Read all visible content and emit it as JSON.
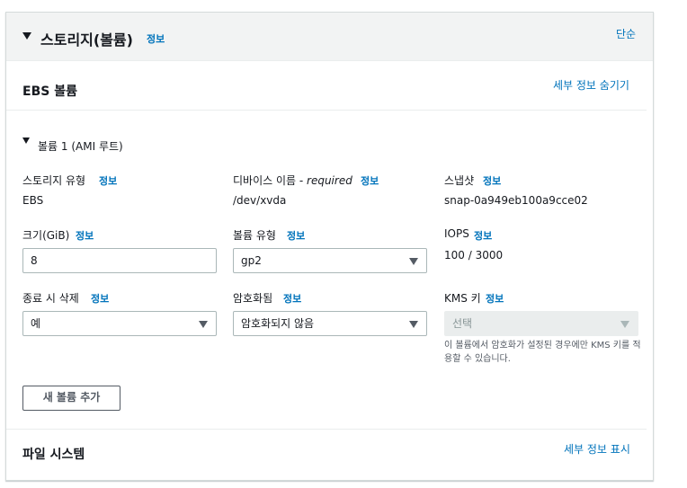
{
  "storage": {
    "title": "스토리지(볼륨)",
    "info": "정보",
    "simple_link": "단순"
  },
  "ebs": {
    "title": "EBS 볼륨",
    "hide_details": "세부 정보 숨기기",
    "volume_title": "볼륨 1 (AMI 루트)",
    "storage_type": {
      "label": "스토리지 유형",
      "info": "정보",
      "value": "EBS"
    },
    "device_name": {
      "label": "디바이스 이름 - ",
      "label_italic": "required",
      "info": "정보",
      "value": "/dev/xvda"
    },
    "snapshot": {
      "label": "스냅샷",
      "info": "정보",
      "value": "snap-0a949eb100a9cce02"
    },
    "size": {
      "label": "크기(GiB)",
      "info": "정보",
      "value": "8"
    },
    "volume_type": {
      "label": "볼륨 유형",
      "info": "정보",
      "value": "gp2"
    },
    "iops": {
      "label": "IOPS",
      "info": "정보",
      "value": "100 / 3000"
    },
    "delete_on_termination": {
      "label": "종료 시 삭제",
      "info": "정보",
      "value": "예"
    },
    "encryption": {
      "label": "암호화됨",
      "info": "정보",
      "value": "암호화되지 않음"
    },
    "kms_key": {
      "label": "KMS 키",
      "info": "정보",
      "placeholder": "선택",
      "hint": "이 볼륨에서 암호화가 설정된 경우에만 KMS 키를 적용할 수 있습니다."
    },
    "add_volume_button": "새 볼륨 추가"
  },
  "filesystem": {
    "title": "파일 시스템",
    "show_details": "세부 정보 표시"
  }
}
